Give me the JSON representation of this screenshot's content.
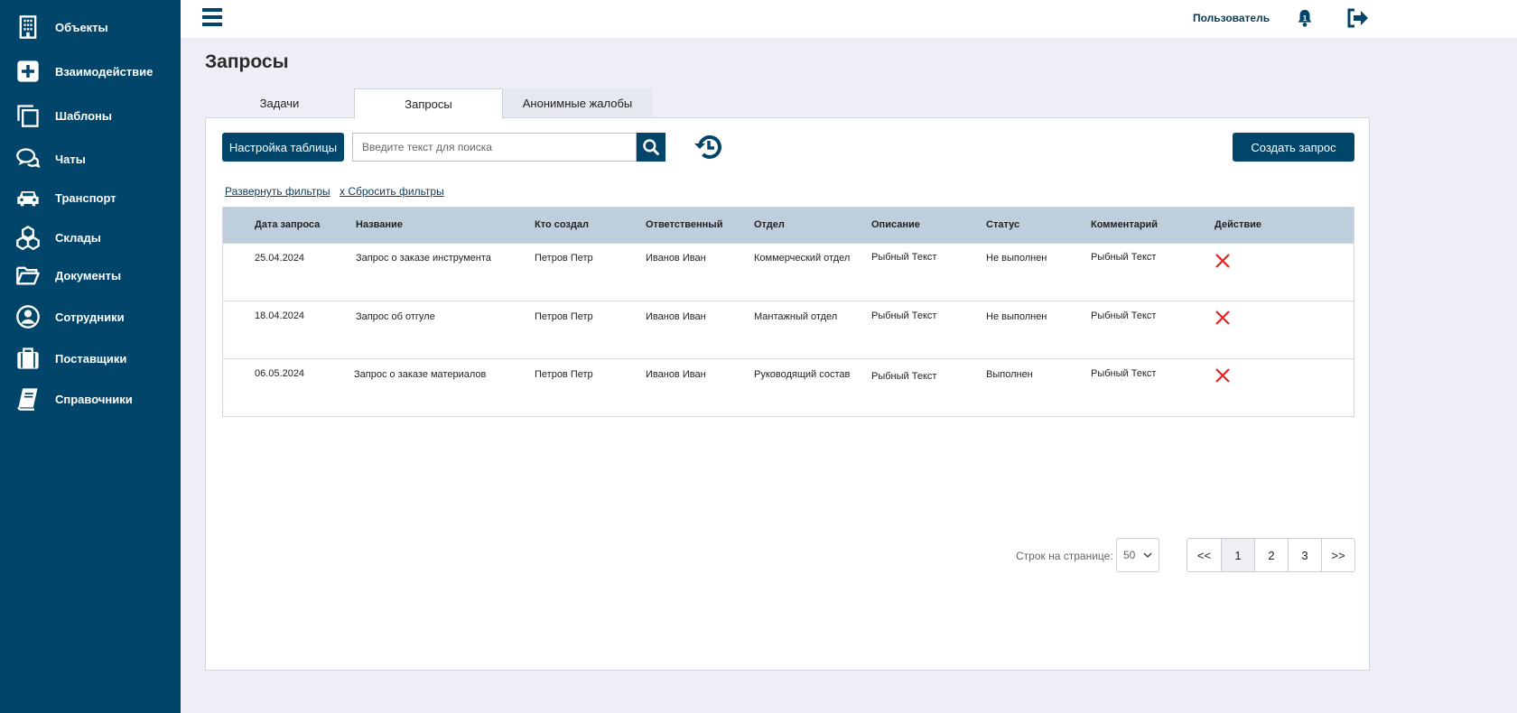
{
  "sidebar": {
    "items": [
      {
        "label": "Объекты",
        "icon": "building-icon"
      },
      {
        "label": "Взаимодействие",
        "icon": "plus-square-icon"
      },
      {
        "label": "Шаблоны",
        "icon": "copy-icon"
      },
      {
        "label": "Чаты",
        "icon": "chat-icon"
      },
      {
        "label": "Транспорт",
        "icon": "car-icon"
      },
      {
        "label": "Склады",
        "icon": "boxes-icon"
      },
      {
        "label": "Документы",
        "icon": "folder-icon"
      },
      {
        "label": "Сотрудники",
        "icon": "user-circle-icon"
      },
      {
        "label": "Поставщики",
        "icon": "briefcase-icon"
      },
      {
        "label": "Справочники",
        "icon": "book-icon"
      }
    ]
  },
  "header": {
    "user_label": "Пользователь"
  },
  "page": {
    "title": "Запросы"
  },
  "tabs": [
    {
      "label": "Задачи"
    },
    {
      "label": "Запросы"
    },
    {
      "label": "Анонимные жалобы"
    }
  ],
  "toolbar": {
    "settings_label": "Настройка таблицы",
    "search_placeholder": "Введите текст для поиска",
    "create_label": "Создать запрос"
  },
  "filters": {
    "expand_label": "Развернуть фильтры",
    "reset_label": "x Сбросить фильтры"
  },
  "table": {
    "headers": [
      "Дата запроса",
      "Название",
      "Кто создал",
      "Ответственный",
      "Отдел",
      "Описание",
      "Статус",
      "Комментарий",
      "Действие"
    ],
    "rows": [
      [
        "25.04.2024",
        "Запрос о заказе инструмента",
        "Петров Петр",
        "Иванов Иван",
        "Коммерческий отдел",
        "Рыбный Текст",
        "Не выполнен",
        "Рыбный Текст"
      ],
      [
        "18.04.2024",
        "Запрос об отгуле",
        "Петров Петр",
        "Иванов Иван",
        "Мантажный отдел",
        "Рыбный Текст",
        "Не выполнен",
        "Рыбный Текст"
      ],
      [
        "06.05.2024",
        "Запрос о заказе материалов",
        "Петров Петр",
        "Иванов Иван",
        "Руководящий состав",
        "Рыбный Текст",
        "Выполнен",
        "Рыбный Текст"
      ]
    ]
  },
  "pagination": {
    "rows_label": "Строк на странице:",
    "rows_value": "50",
    "pages": [
      "<<",
      "1",
      "2",
      "3",
      ">>"
    ],
    "current_page": "1"
  },
  "colors": {
    "sidebar": "#01466a",
    "header_row": "#bfcedd",
    "delete": "#e02424"
  }
}
